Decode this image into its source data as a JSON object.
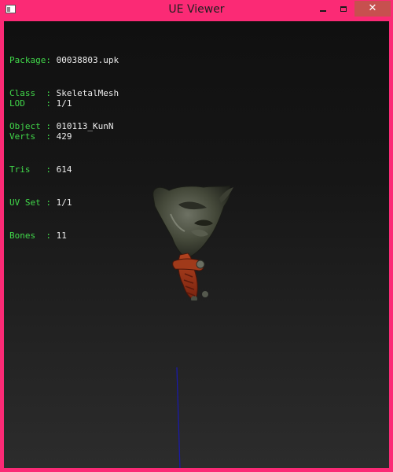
{
  "window": {
    "title": "UE Viewer",
    "icon": "app-icon",
    "controls": {
      "minimize_icon": "minimize-icon",
      "maximize_icon": "maximize-icon",
      "close_label": "✕"
    },
    "accent_color": "#fb2a75",
    "close_button_color": "#c7504f"
  },
  "info": {
    "key_color": "#41d84a",
    "value_color": "#ececec",
    "package": {
      "label": "Package:",
      "value": "00038803.upk"
    },
    "class": {
      "label": "Class  :",
      "value": "SkeletalMesh"
    },
    "object": {
      "label": "Object :",
      "value": "010113_KunN"
    },
    "lod": {
      "label": "LOD    :",
      "value": "1/1"
    },
    "verts": {
      "label": "Verts  :",
      "value": "429"
    },
    "tris": {
      "label": "Tris   :",
      "value": "614"
    },
    "uvset": {
      "label": "UV Set :",
      "value": "1/1"
    },
    "bones": {
      "label": "Bones  :",
      "value": "11"
    }
  },
  "viewport": {
    "background_top": "#101010",
    "background_bottom": "#2c2c2c",
    "axis_color": "#1a1aa8"
  }
}
